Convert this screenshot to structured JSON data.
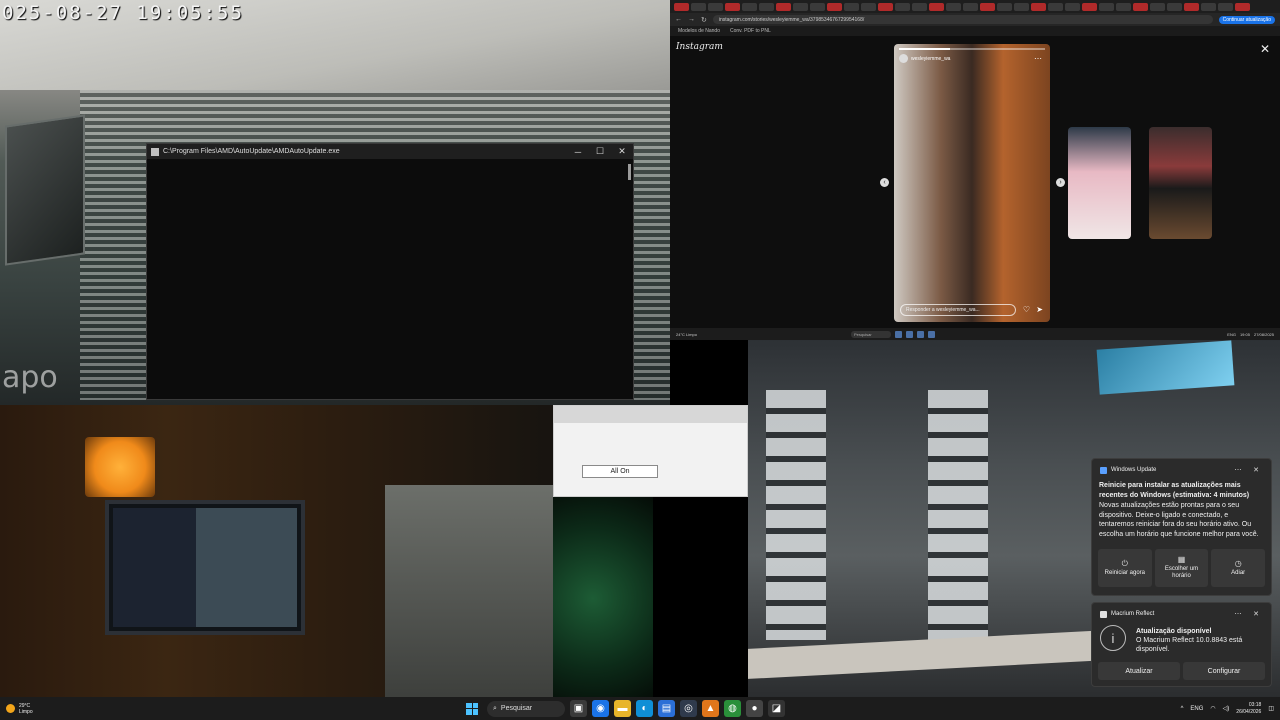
{
  "camera": {
    "timestamp": "025-08-27 19:05:55",
    "watermark": "apo"
  },
  "console_window": {
    "title": "C:\\Program Files\\AMD\\AutoUpdate\\AMDAutoUpdate.exe",
    "minimize": "─",
    "maximize": "☐",
    "close": "✕"
  },
  "dialog": {
    "button_label": "All On"
  },
  "browser": {
    "url": "instagram.com/stories/wesleyiemme_wa/3798534676729954168/",
    "continue_label": "Continuar atualização",
    "bookmarks": [
      "Modelos de Nando",
      "Conv. PDF to PNL"
    ],
    "nav_back": "←",
    "nav_forward": "→",
    "nav_reload": "↻",
    "instagram": {
      "logo": "Instagram",
      "close": "✕",
      "story_username": "wesleyiemme_wa",
      "story_menu": "⋯",
      "story_progress": 0.35,
      "reply_placeholder": "Responder a wesleyiemme_wa...",
      "heart": "♡",
      "send": "➤",
      "prev": "‹",
      "next": "›"
    },
    "taskbar": {
      "weather": "24°C Limpo",
      "search": "Pesquisar",
      "lang": "ENG",
      "time": "19:05",
      "date": "27/08/2025"
    }
  },
  "notifications": {
    "windows_update": {
      "app": "Windows Update",
      "more": "⋯",
      "close": "✕",
      "title": "Reinicie para instalar as atualizações mais recentes do Windows (estimativa: 4 minutos)",
      "body": "Novas atualizações estão prontas para o seu dispositivo. Deixe-o ligado e conectado, e tentaremos reiniciar fora do seu horário ativo. Ou escolha um horário que funcione melhor para você.",
      "actions": [
        {
          "icon": "power-icon",
          "glyph": "⏻",
          "label": "Reiniciar agora"
        },
        {
          "icon": "calendar-icon",
          "glyph": "▦",
          "label": "Escolher um horário"
        },
        {
          "icon": "postpone-icon",
          "glyph": "◷",
          "label": "Adiar"
        }
      ]
    },
    "macrium": {
      "app": "Macrium Reflect",
      "more": "⋯",
      "close": "✕",
      "info_glyph": "i",
      "title": "Atualização disponível",
      "body": "O Macrium Reflect 10.0.8843 está disponível.",
      "update": "Atualizar",
      "configure": "Configurar"
    }
  },
  "taskbar": {
    "weather_temp": "29°C",
    "weather_desc": "Limpo",
    "search_placeholder": "Pesquisar",
    "lang": "ENG",
    "time": "03:18",
    "date": "26/04/2026",
    "chevron": "^",
    "apps": [
      {
        "name": "task-view-icon",
        "glyph": "▣",
        "color": "#3a3a3a"
      },
      {
        "name": "chrome-icon",
        "glyph": "◉",
        "color": "#1a73e8"
      },
      {
        "name": "file-explorer-icon",
        "glyph": "▬",
        "color": "#e8b52a"
      },
      {
        "name": "edge-icon",
        "glyph": "◐",
        "color": "#0f8fd6"
      },
      {
        "name": "store-icon",
        "glyph": "▤",
        "color": "#2b6fd6"
      },
      {
        "name": "steam-icon",
        "glyph": "◎",
        "color": "#2f3a4c"
      },
      {
        "name": "vlc-icon",
        "glyph": "▲",
        "color": "#e0761b"
      },
      {
        "name": "browser-icon",
        "glyph": "◍",
        "color": "#2a8f3a"
      },
      {
        "name": "obs-icon",
        "glyph": "●",
        "color": "#444444"
      },
      {
        "name": "amd-icon",
        "glyph": "◪",
        "color": "#333333"
      }
    ]
  },
  "colors": {
    "accent": "#4cc2ff",
    "toast_bg": "#2b2b2b",
    "taskbar_bg": "#1c1c1c"
  }
}
